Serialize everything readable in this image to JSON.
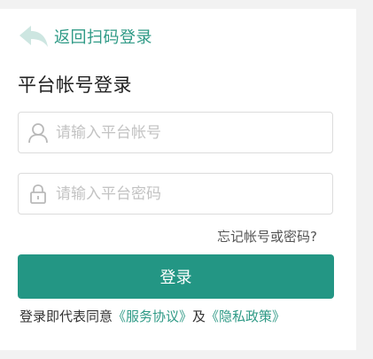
{
  "back": {
    "label": "返回扫码登录",
    "icon": "back-arrow-icon",
    "color": "#2f9a86"
  },
  "title": "平台帐号登录",
  "form": {
    "account_placeholder": "请输入平台帐号",
    "account_value": "",
    "account_icon": "user-icon",
    "password_placeholder": "请输入平台密码",
    "password_value": "",
    "password_icon": "lock-icon"
  },
  "forgot_label": "忘记帐号或密码?",
  "login_label": "登录",
  "agreement": {
    "prefix": "登录即代表同意",
    "service_link": "《服务协议》",
    "connector": "及",
    "privacy_link": "《隐私政策》"
  },
  "colors": {
    "accent": "#239684",
    "link": "#2f9a86"
  }
}
